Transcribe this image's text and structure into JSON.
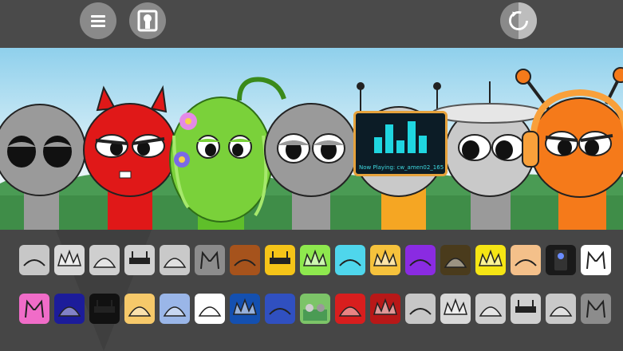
{
  "header": {
    "menu_icon": "hamburger-icon",
    "gallery_icon": "keyhole-portrait-icon",
    "reset_icon": "refresh-icon"
  },
  "stage": {
    "now_playing": "Now Playing: cw_amen02_165"
  },
  "palette": {
    "row1": [
      {
        "name": "gray-headband",
        "bg": "#c7c7c7"
      },
      {
        "name": "white-spiky-hair",
        "bg": "#d9d9d9"
      },
      {
        "name": "satellite-dish",
        "bg": "#cfcfcf"
      },
      {
        "name": "black-antenna-bar",
        "bg": "#d0d0d0"
      },
      {
        "name": "curly-cap",
        "bg": "#c9c9c9"
      },
      {
        "name": "gray-cat-ears",
        "bg": "#8c8c8c"
      },
      {
        "name": "brown-block",
        "bg": "#a6531c"
      },
      {
        "name": "yellow-visor",
        "bg": "#f5c418"
      },
      {
        "name": "green-spikes",
        "bg": "#8ee84e"
      },
      {
        "name": "blue-headphones",
        "bg": "#4fd6ec"
      },
      {
        "name": "yellow-crown",
        "bg": "#f6c23c"
      },
      {
        "name": "purple-horns",
        "bg": "#8a2be2"
      },
      {
        "name": "olive-cap",
        "bg": "#4a3b1c"
      },
      {
        "name": "yellow-lightning",
        "bg": "#f5e514"
      },
      {
        "name": "tan-hat",
        "bg": "#f4c08a"
      },
      {
        "name": "dark-speaker",
        "bg": "#1a1a1a"
      },
      {
        "name": "white-cat-ears",
        "bg": "#ffffff"
      }
    ],
    "row2": [
      {
        "name": "pink-bunny-ears",
        "bg": "#f06cc8"
      },
      {
        "name": "navy-helmet",
        "bg": "#1c1c9a"
      },
      {
        "name": "black-bench",
        "bg": "#111111"
      },
      {
        "name": "yellow-bun",
        "bg": "#f6c96a"
      },
      {
        "name": "blue-dome",
        "bg": "#9ab6e8"
      },
      {
        "name": "white-arc",
        "bg": "#ffffff"
      },
      {
        "name": "blue-crown",
        "bg": "#1450b0"
      },
      {
        "name": "blue-flag",
        "bg": "#3050c0"
      },
      {
        "name": "garden-scene",
        "bg": "#7cc468"
      },
      {
        "name": "red-green-cap",
        "bg": "#d81e1e"
      },
      {
        "name": "red-mane",
        "bg": "#b81818"
      },
      {
        "name": "gray-headband",
        "bg": "#c7c7c7"
      },
      {
        "name": "white-spiky-hair",
        "bg": "#d9d9d9"
      },
      {
        "name": "satellite-dish",
        "bg": "#cfcfcf"
      },
      {
        "name": "black-antenna-bar",
        "bg": "#d0d0d0"
      },
      {
        "name": "curly-cap",
        "bg": "#c9c9c9"
      },
      {
        "name": "gray-cat-ears",
        "bg": "#8c8c8c"
      }
    ]
  }
}
